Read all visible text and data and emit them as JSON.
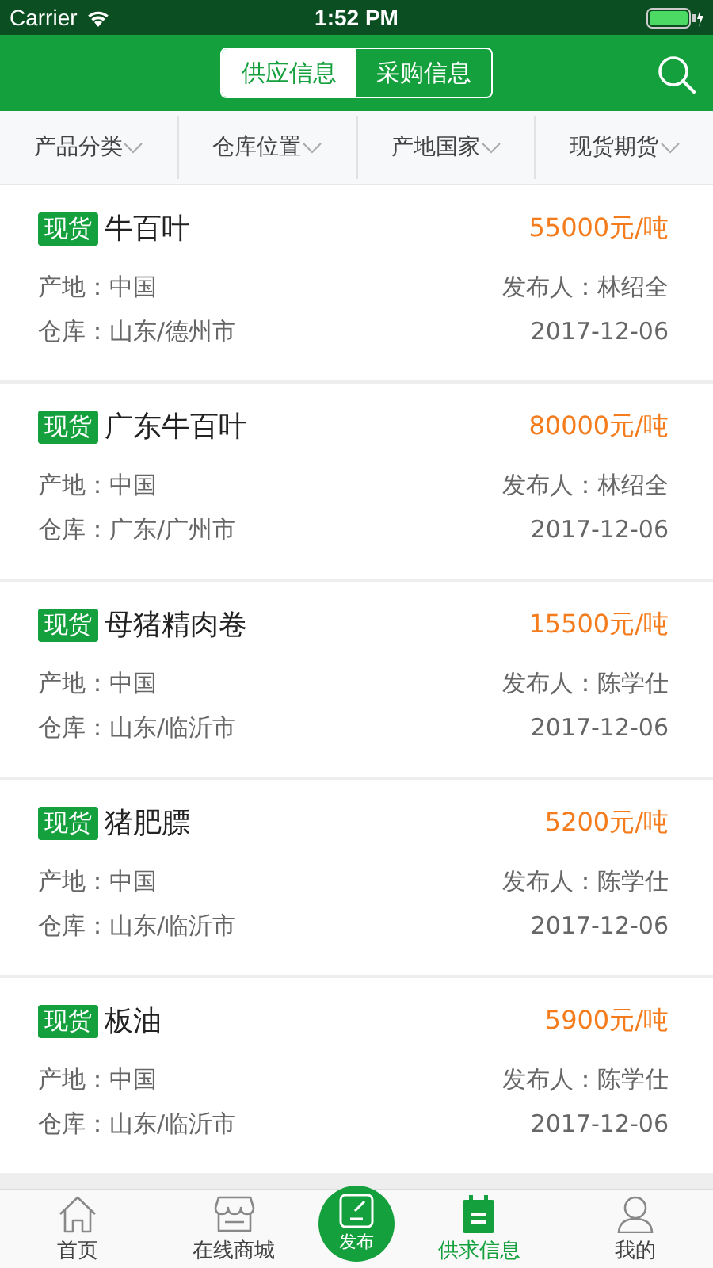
{
  "status_bar": {
    "carrier": "Carrier",
    "time": "1:52 PM"
  },
  "header": {
    "segments": [
      {
        "label": "供应信息",
        "selected": true
      },
      {
        "label": "采购信息",
        "selected": false
      }
    ]
  },
  "filters": [
    {
      "label": "产品分类"
    },
    {
      "label": "仓库位置"
    },
    {
      "label": "产地国家"
    },
    {
      "label": "现货期货"
    }
  ],
  "listings": [
    {
      "tag": "现货",
      "name": "牛百叶",
      "price": "55000元/吨",
      "origin": "产地：中国",
      "publisher": "发布人：林绍全",
      "warehouse": "仓库：山东/德州市",
      "date": "2017-12-06"
    },
    {
      "tag": "现货",
      "name": "广东牛百叶",
      "price": "80000元/吨",
      "origin": "产地：中国",
      "publisher": "发布人：林绍全",
      "warehouse": "仓库：广东/广州市",
      "date": "2017-12-06"
    },
    {
      "tag": "现货",
      "name": "母猪精肉卷",
      "price": "15500元/吨",
      "origin": "产地：中国",
      "publisher": "发布人：陈学仕",
      "warehouse": "仓库：山东/临沂市",
      "date": "2017-12-06"
    },
    {
      "tag": "现货",
      "name": "猪肥膘",
      "price": "5200元/吨",
      "origin": "产地：中国",
      "publisher": "发布人：陈学仕",
      "warehouse": "仓库：山东/临沂市",
      "date": "2017-12-06"
    },
    {
      "tag": "现货",
      "name": "板油",
      "price": "5900元/吨",
      "origin": "产地：中国",
      "publisher": "发布人：陈学仕",
      "warehouse": "仓库：山东/临沂市",
      "date": "2017-12-06"
    }
  ],
  "tab_bar": [
    {
      "kind": "home",
      "label": "首页",
      "selected": false
    },
    {
      "kind": "store",
      "label": "在线商城",
      "selected": false
    },
    {
      "kind": "publish",
      "label": "发布",
      "selected": false
    },
    {
      "kind": "list",
      "label": "供求信息",
      "selected": true
    },
    {
      "kind": "user",
      "label": "我的",
      "selected": false
    }
  ]
}
